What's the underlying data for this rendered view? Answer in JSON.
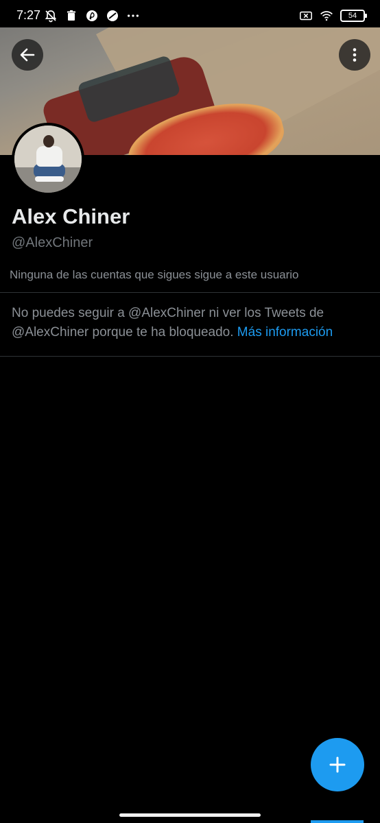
{
  "status_bar": {
    "time": "7:27",
    "battery": "54",
    "left_icons": [
      "mute-bell-icon",
      "trash-icon",
      "pinterest-icon",
      "app-icon",
      "more-dots-icon"
    ],
    "right_icons": [
      "sim-x-icon",
      "wifi-icon",
      "battery-icon"
    ]
  },
  "profile": {
    "name": "Alex Chiner",
    "handle": "@AlexChiner",
    "followers_note": "Ninguna de las cuentas que sigues sigue a este usuario"
  },
  "blocked": {
    "message": "No puedes seguir a @AlexChiner ni ver los Tweets de @AlexChiner porque te ha bloqueado.",
    "link_label": "Más información"
  },
  "colors": {
    "accent": "#1d9bf0",
    "background": "#000000",
    "secondary_text": "#71767b"
  }
}
